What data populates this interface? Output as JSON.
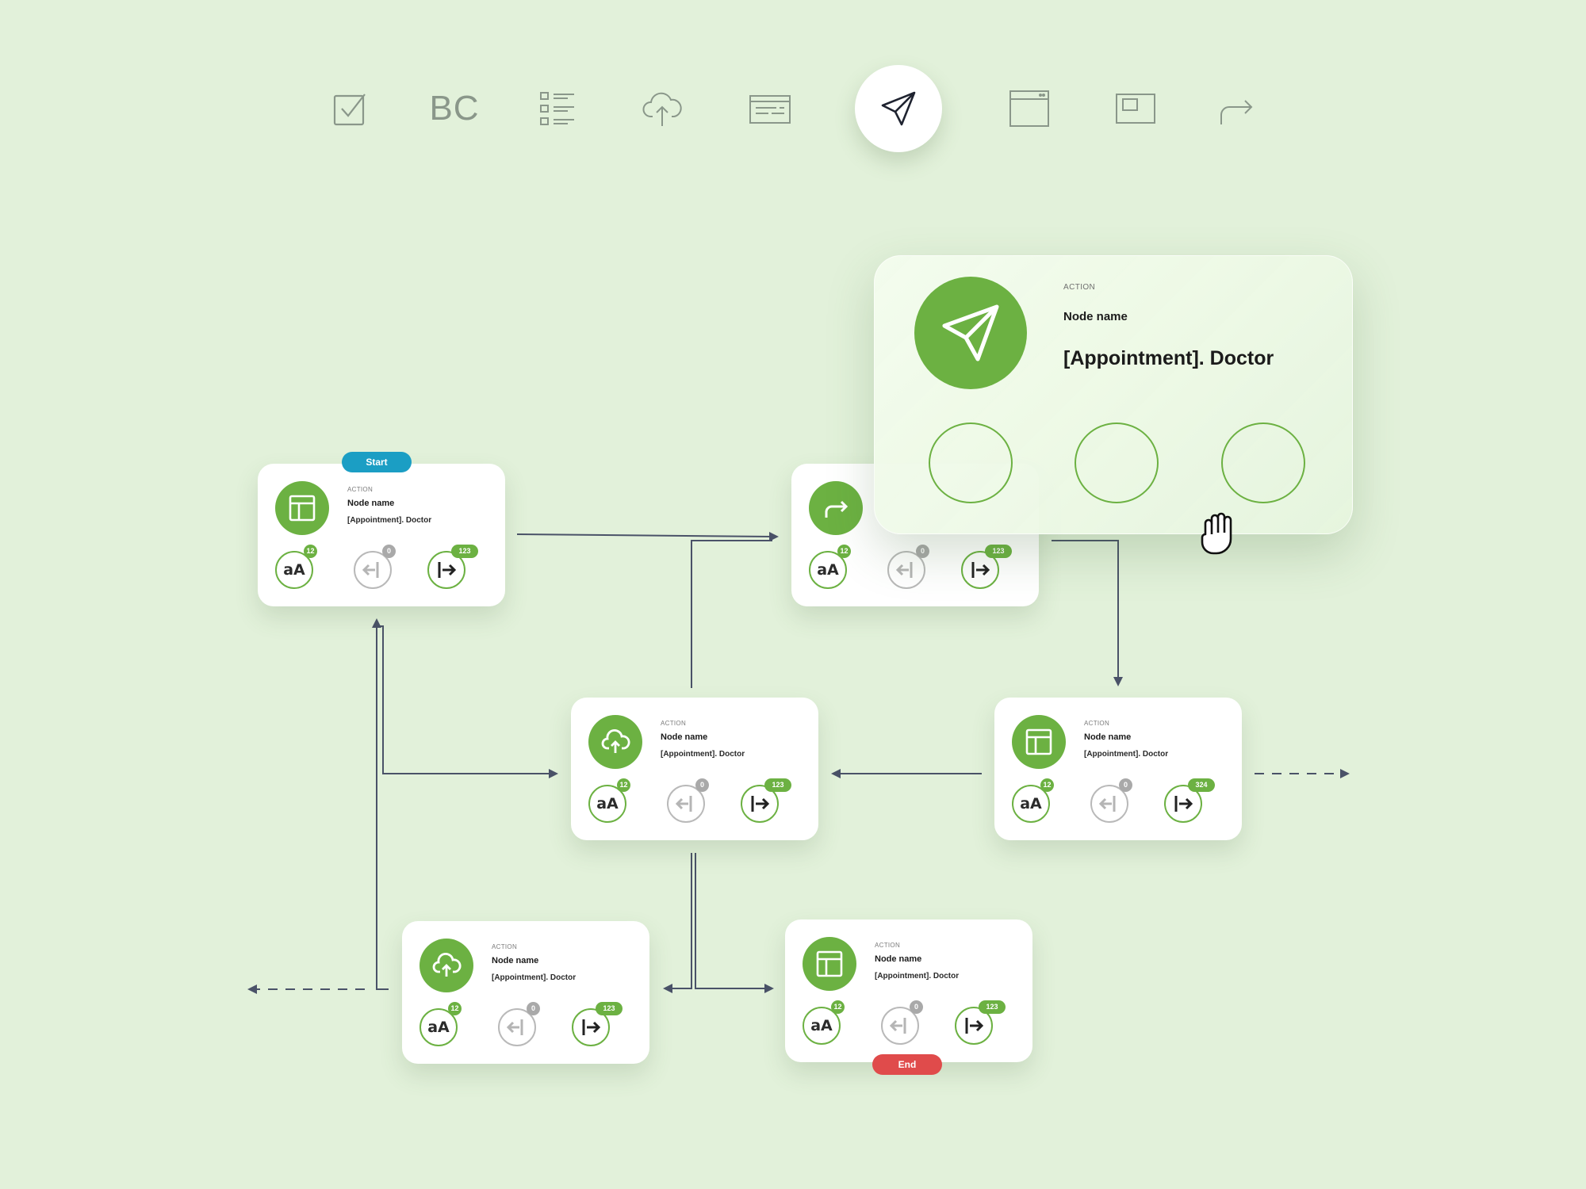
{
  "toolbar": {
    "items": [
      {
        "id": "checkbox",
        "icon": "checkbox-icon"
      },
      {
        "id": "bc",
        "icon": "bc-text-icon",
        "label": "BC"
      },
      {
        "id": "list",
        "icon": "checklist-icon"
      },
      {
        "id": "upload",
        "icon": "cloud-upload-icon"
      },
      {
        "id": "form",
        "icon": "form-icon"
      },
      {
        "id": "send",
        "icon": "send-icon",
        "active": true
      },
      {
        "id": "window",
        "icon": "browser-window-icon"
      },
      {
        "id": "frame",
        "icon": "frame-icon"
      },
      {
        "id": "redirect",
        "icon": "redirect-arrow-icon"
      }
    ]
  },
  "nodes": [
    {
      "id": "n1",
      "icon": "layout-icon",
      "kind": "ACTION",
      "name": "Node name",
      "subtitle": "[Appointment]. Doctor",
      "pins": [
        {
          "icon": "text-aa-icon",
          "label": "aA",
          "badge": "12"
        },
        {
          "icon": "input-arrow-icon",
          "badge": "0"
        },
        {
          "icon": "output-arrow-icon",
          "badge": "123"
        }
      ]
    },
    {
      "id": "n2",
      "icon": "redirect-icon",
      "kind": "",
      "name": "",
      "subtitle": "",
      "pins": [
        {
          "icon": "text-aa-icon",
          "label": "aA",
          "badge": "12"
        },
        {
          "icon": "input-arrow-icon",
          "badge": "0"
        },
        {
          "icon": "output-arrow-icon",
          "badge": "123"
        }
      ]
    },
    {
      "id": "n3",
      "icon": "cloud-upload-icon",
      "kind": "ACTION",
      "name": "Node name",
      "subtitle": "[Appointment]. Doctor",
      "pins": [
        {
          "icon": "text-aa-icon",
          "label": "aA",
          "badge": "12"
        },
        {
          "icon": "input-arrow-icon",
          "badge": "0"
        },
        {
          "icon": "output-arrow-icon",
          "badge": "123"
        }
      ]
    },
    {
      "id": "n4",
      "icon": "layout-icon",
      "kind": "ACTION",
      "name": "Node name",
      "subtitle": "[Appointment]. Doctor",
      "pins": [
        {
          "icon": "text-aa-icon",
          "label": "aA",
          "badge": "12"
        },
        {
          "icon": "input-arrow-icon",
          "badge": "0"
        },
        {
          "icon": "output-arrow-icon",
          "badge": "324"
        }
      ]
    },
    {
      "id": "n5",
      "icon": "cloud-upload-icon",
      "kind": "ACTION",
      "name": "Node name",
      "subtitle": "[Appointment]. Doctor",
      "pins": [
        {
          "icon": "text-aa-icon",
          "label": "aA",
          "badge": "12"
        },
        {
          "icon": "input-arrow-icon",
          "badge": "0"
        },
        {
          "icon": "output-arrow-icon",
          "badge": "123"
        }
      ]
    },
    {
      "id": "n6",
      "icon": "layout-icon",
      "kind": "ACTION",
      "name": "Node name",
      "subtitle": "[Appointment]. Doctor",
      "pins": [
        {
          "icon": "text-aa-icon",
          "label": "aA",
          "badge": "12"
        },
        {
          "icon": "input-arrow-icon",
          "badge": "0"
        },
        {
          "icon": "output-arrow-icon",
          "badge": "123"
        }
      ]
    }
  ],
  "labels": {
    "start": "Start",
    "end": "End"
  },
  "detail_card": {
    "icon": "send-icon",
    "kind": "ACTION",
    "name": "Node name",
    "subtitle": "[Appointment]. Doctor"
  },
  "cursor": {
    "icon": "hand-grab-icon"
  },
  "colors": {
    "background": "#e2f1da",
    "accent": "#6cb142",
    "start": "#1b9ec4",
    "end": "#e04b4b",
    "connector": "#4a5268"
  }
}
